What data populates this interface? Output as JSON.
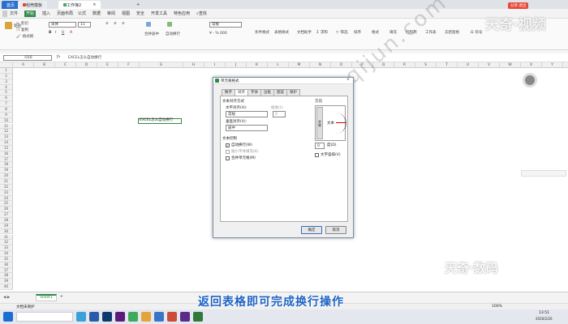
{
  "tabs": {
    "home": "首页",
    "templates": "稻壳模板",
    "workbook": "工作簿2"
  },
  "menu": [
    "文件",
    "开始",
    "插入",
    "页面布局",
    "公式",
    "数据",
    "审阅",
    "视图",
    "安全",
    "开发工具",
    "特色应用",
    "查找"
  ],
  "ribbon": {
    "paste": "粘贴",
    "cut": "剪切",
    "copy": "复制",
    "format_painter": "格式刷",
    "font": "宋体",
    "size": "11",
    "merge": "合并居中",
    "wrap": "自动换行",
    "number_format": "常规",
    "cond_format": "条件格式",
    "table_style": "表格样式",
    "doc_helper": "文档助手",
    "sum": "求和",
    "filter": "筛选",
    "sort": "排序",
    "format": "格式",
    "fill": "填充",
    "row_col": "行和列",
    "worksheet": "工作表",
    "freeze": "冻结窗格",
    "symbol": "符号",
    "share": "分享·退出"
  },
  "formula": {
    "cell_ref": "O10",
    "content": "EXCEL怎么自动换行"
  },
  "columns": [
    "A",
    "B",
    "C",
    "D",
    "E",
    "F",
    "G",
    "H",
    "I",
    "J",
    "K",
    "L",
    "M",
    "N",
    "O",
    "P",
    "Q",
    "R",
    "S",
    "T",
    "U",
    "V",
    "W",
    "X",
    "Y",
    "Z"
  ],
  "rows": [
    "1",
    "2",
    "3",
    "4",
    "5",
    "6",
    "7",
    "8",
    "9",
    "10",
    "11",
    "12",
    "13",
    "14",
    "15",
    "16",
    "17",
    "18",
    "19",
    "20",
    "21",
    "22",
    "23",
    "24",
    "25",
    "26",
    "27",
    "28",
    "29",
    "30",
    "31",
    "32",
    "33",
    "34",
    "35",
    "36",
    "37",
    "38",
    "39",
    "40"
  ],
  "cell_text": "EXCEL怎么自动换行",
  "dialog": {
    "title": "单元格格式",
    "tabs": [
      "数字",
      "对齐",
      "字体",
      "边框",
      "图案",
      "保护"
    ],
    "section_align": "文本对齐方式",
    "horizontal_label": "水平对齐(H):",
    "horizontal_value": "常规",
    "indent_label": "缩进(I):",
    "indent_value": "0",
    "vertical_label": "垂直对齐(V):",
    "vertical_value": "居中",
    "section_control": "文本控制",
    "wrap_text": "自动换行(W)",
    "shrink": "缩小字体填充(K)",
    "merge_cells": "合并单元格(M)",
    "orientation_label": "方向",
    "vertical_text": "文本",
    "dial_text": "文本",
    "degrees_value": "0",
    "degrees_label": "度(D)",
    "vertical_text_check": "文字竖排(V)",
    "ok": "确定",
    "cancel": "取消"
  },
  "sheet_tab": "Sheet1",
  "status": {
    "left": "文档未保护",
    "zoom": "100%"
  },
  "caption": "返回表格即可完成换行操作",
  "watermark_diag": "shuma.tianqijun.com",
  "watermark_top": "天奇·视频",
  "watermark_bottom": "天奇·数码",
  "clock": {
    "time": "13:51",
    "date": "2020/2/26"
  },
  "colors": {
    "accent": "#2f8a4a",
    "caption": "#1e63c4",
    "wps_green": "#3daa5c"
  }
}
